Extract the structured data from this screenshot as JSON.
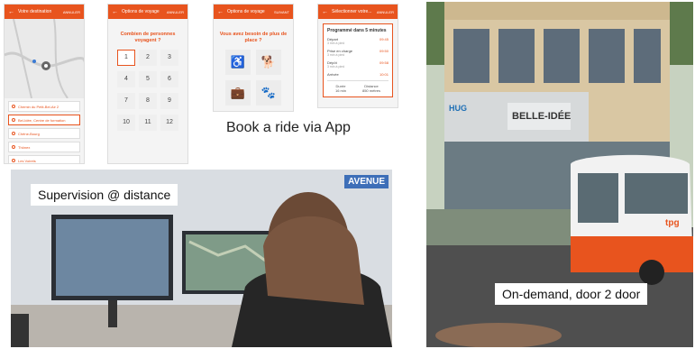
{
  "phones": [
    {
      "title": "Votre destination",
      "action": "ANNULER",
      "list": [
        "Chemin du Petit-Bel-Air 2",
        "Bel-Idée, Centre de formation",
        "Chêne-Bourg",
        "Thônex",
        "Les Voirets"
      ],
      "selected": 1
    },
    {
      "title": "Options de voyage",
      "action": "ANNULER",
      "question": "Combien de personnes voyagent ?",
      "numbers": [
        "1",
        "2",
        "3",
        "4",
        "5",
        "6",
        "7",
        "8",
        "9",
        "10",
        "11",
        "12"
      ],
      "selected": "1"
    },
    {
      "title": "Options de voyage",
      "action": "SUIVANT",
      "question": "Vous avez besoin de plus de place ?",
      "needs": [
        "wheelchair-icon",
        "dog-icon",
        "luggage-icon",
        "paw-icon"
      ]
    },
    {
      "title": "Sélectionner votre...",
      "action": "ANNULER",
      "sched_title": "Programmé dans 5 minutes",
      "stops": [
        {
          "name": "Départ",
          "sub": "3 min à pied",
          "time": "09:45"
        },
        {
          "name": "Prise en charge",
          "sub": "3 min à pied",
          "time": "09:50"
        },
        {
          "name": "Dépôt",
          "sub": "3 min à pied",
          "time": "09:58"
        },
        {
          "name": "Arrivée",
          "sub": "",
          "time": "10:01"
        }
      ],
      "stats": [
        {
          "label": "Durée",
          "value": "16 min"
        },
        {
          "label": "Distance",
          "value": "850 mètres"
        }
      ]
    }
  ],
  "captions": {
    "book": "Book a ride via App",
    "supervision": "Supervision @ distance",
    "on_demand": "On-demand, door 2 door"
  },
  "logos": {
    "avenue": "AVENUE",
    "hug": "HUG",
    "building": "BELLE-IDÉE",
    "tpg": "tpg"
  },
  "colors": {
    "accent": "#e8541e"
  }
}
